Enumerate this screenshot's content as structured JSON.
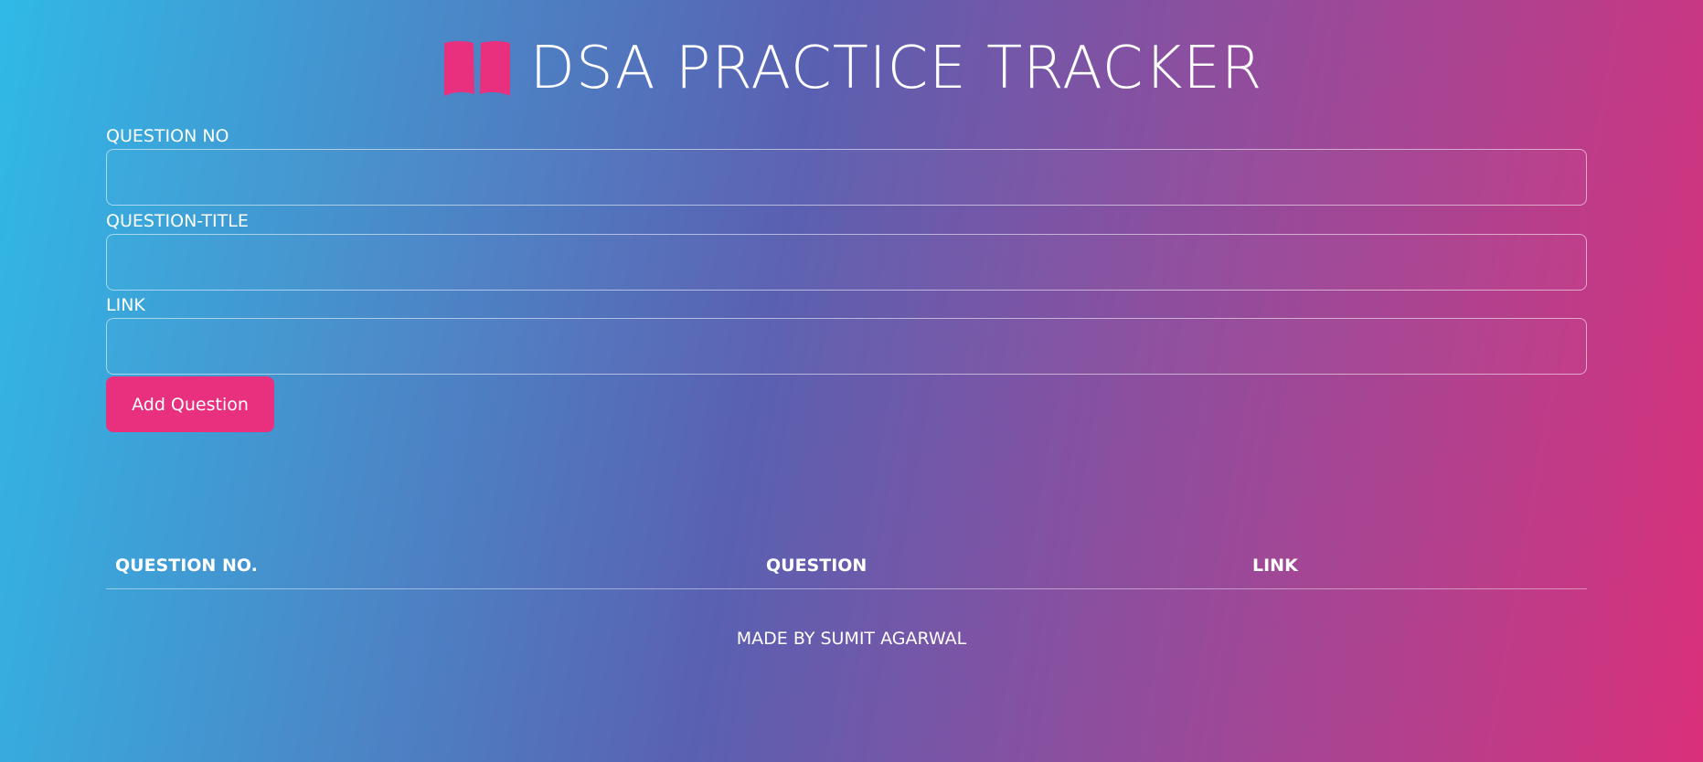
{
  "header": {
    "icon": "book-open-icon",
    "icon_color": "#e8307f",
    "title": "DSA PRACTICE TRACKER"
  },
  "form": {
    "question_no": {
      "label": "QUESTION NO",
      "value": "",
      "placeholder": ""
    },
    "question_title": {
      "label": "QUESTION-TITLE",
      "value": "",
      "placeholder": ""
    },
    "link": {
      "label": "LINK",
      "value": "",
      "placeholder": ""
    },
    "add_button_label": "Add Question"
  },
  "table": {
    "columns": [
      "QUESTION NO.",
      "QUESTION",
      "LINK"
    ],
    "rows": []
  },
  "footer": {
    "text": "MADE BY SUMIT AGARWAL"
  },
  "colors": {
    "accent": "#e8307f",
    "gradient_start": "#30b9e6",
    "gradient_end": "#da2f7a"
  }
}
